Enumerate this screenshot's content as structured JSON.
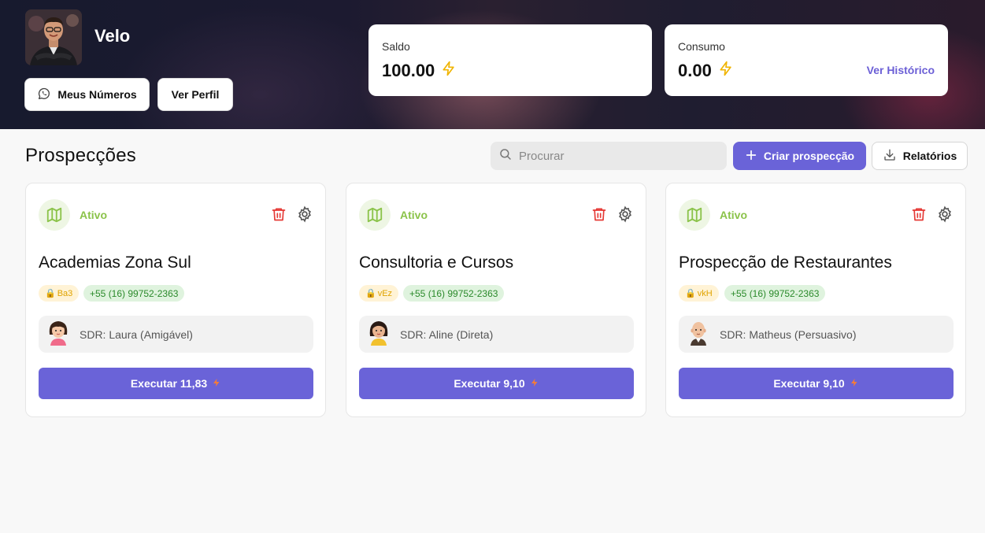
{
  "profile": {
    "name": "Velo",
    "buttons": {
      "numbers": "Meus Números",
      "profile": "Ver Perfil"
    }
  },
  "balance": {
    "label": "Saldo",
    "value": "100.00"
  },
  "consumption": {
    "label": "Consumo",
    "value": "0.00",
    "history_link": "Ver Histórico"
  },
  "section": {
    "title": "Prospecções",
    "search_placeholder": "Procurar",
    "create_label": "Criar prospecção",
    "reports_label": "Relatórios"
  },
  "cards": [
    {
      "status": "Ativo",
      "title": "Academias Zona Sul",
      "code": "Ba3",
      "phone": "+55 (16) 99752-2363",
      "sdr": "SDR: Laura (Amigável)",
      "execute": "Executar 11,83"
    },
    {
      "status": "Ativo",
      "title": "Consultoria e Cursos",
      "code": "vEz",
      "phone": "+55 (16) 99752-2363",
      "sdr": "SDR: Aline (Direta)",
      "execute": "Executar 9,10"
    },
    {
      "status": "Ativo",
      "title": "Prospecção de Restaurantes",
      "code": "vkH",
      "phone": "+55 (16) 99752-2363",
      "sdr": "SDR: Matheus (Persuasivo)",
      "execute": "Executar 9,10"
    }
  ],
  "colors": {
    "accent": "#6a63d8",
    "active": "#8bc34a",
    "danger": "#e53935",
    "bolt": "#f0b400"
  }
}
